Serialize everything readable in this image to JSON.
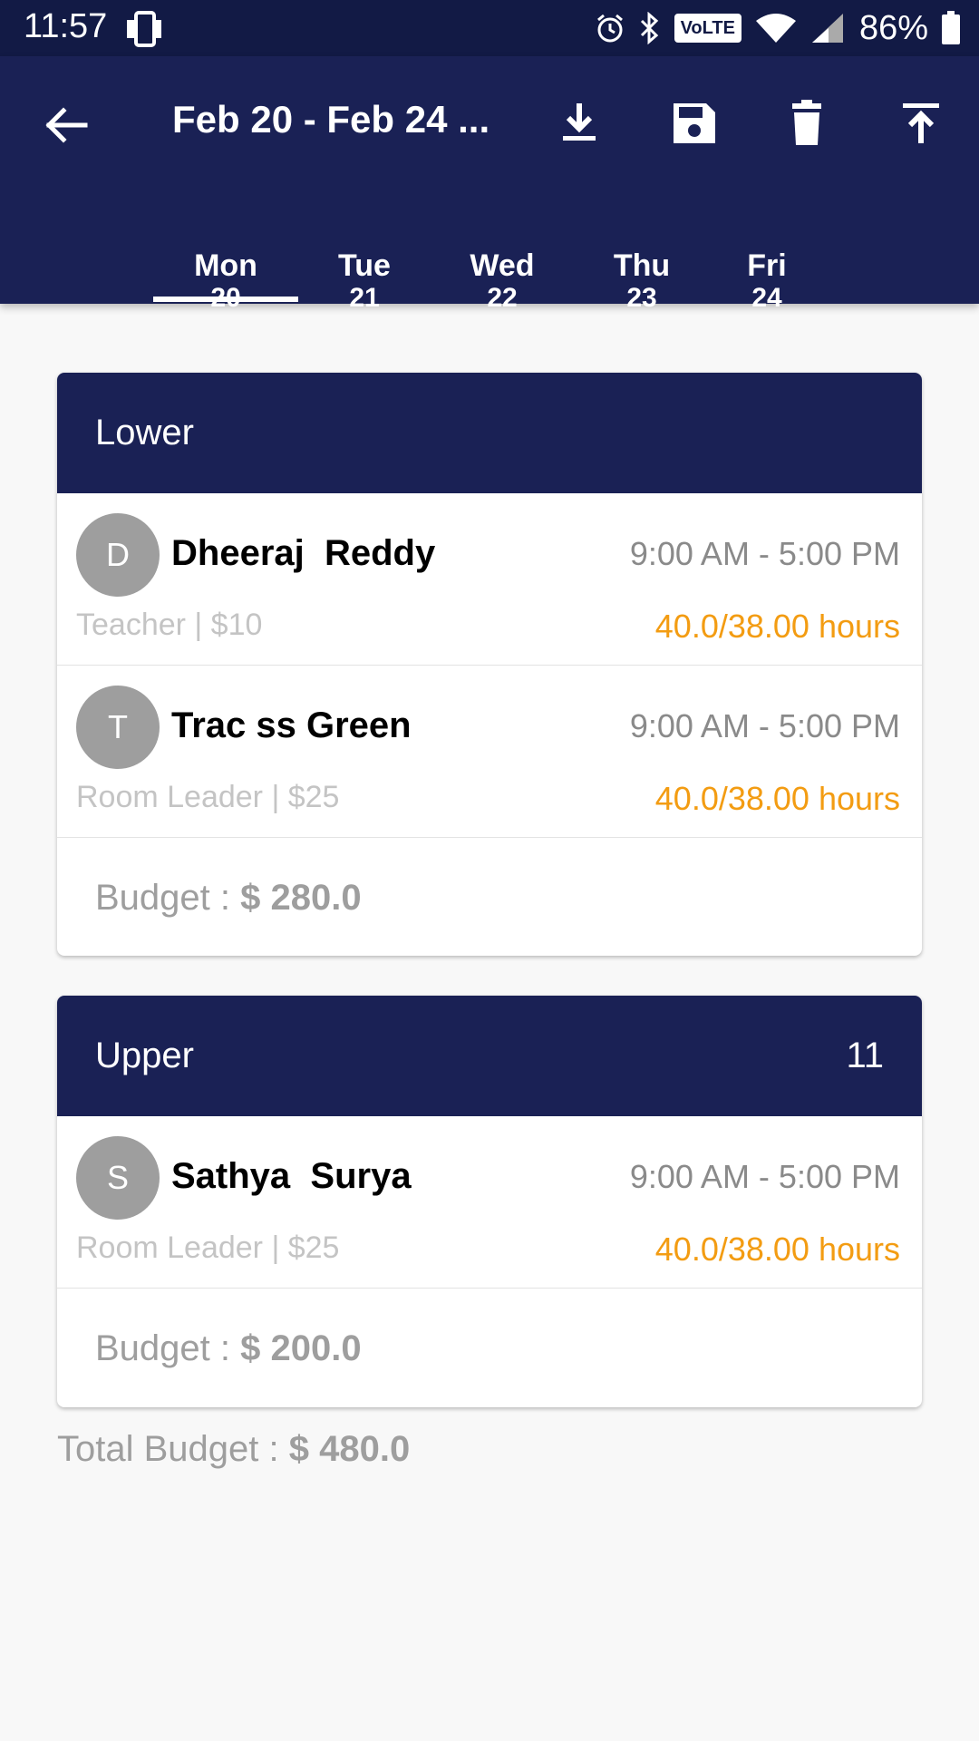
{
  "status_bar": {
    "time": "11:57",
    "volte": "VoLTE",
    "battery": "86%"
  },
  "appbar": {
    "title": "Feb 20 - Feb 24 ...",
    "tabs": [
      {
        "day": "Mon",
        "date": "20"
      },
      {
        "day": "Tue",
        "date": "21"
      },
      {
        "day": "Wed",
        "date": "22"
      },
      {
        "day": "Thu",
        "date": "23"
      },
      {
        "day": "Fri",
        "date": "24"
      }
    ],
    "selected_tab": "Mon"
  },
  "rooms": [
    {
      "name": "Lower",
      "count": "",
      "staff": [
        {
          "initial": "D",
          "name": "Dheeraj  Reddy",
          "time": "9:00 AM - 5:00 PM",
          "role": "Teacher | $10",
          "hours": "40.0/38.00 hours"
        },
        {
          "initial": "T",
          "name": "Trac ss Green",
          "time": "9:00 AM - 5:00 PM",
          "role": "Room Leader | $25",
          "hours": "40.0/38.00 hours"
        }
      ],
      "budget_label": "Budget : ",
      "budget_value": "$ 280.0"
    },
    {
      "name": "Upper",
      "count": "11",
      "staff": [
        {
          "initial": "S",
          "name": "Sathya  Surya",
          "time": "9:00 AM - 5:00 PM",
          "role": "Room Leader | $25",
          "hours": "40.0/38.00 hours"
        }
      ],
      "budget_label": "Budget : ",
      "budget_value": "$ 200.0"
    }
  ],
  "total": {
    "label": "Total Budget : ",
    "value": "$ 480.0"
  },
  "colors": {
    "primary": "#1a2155",
    "status_bar": "#121a45",
    "hours": "#f39c12",
    "avatar": "#9e9e9e"
  }
}
